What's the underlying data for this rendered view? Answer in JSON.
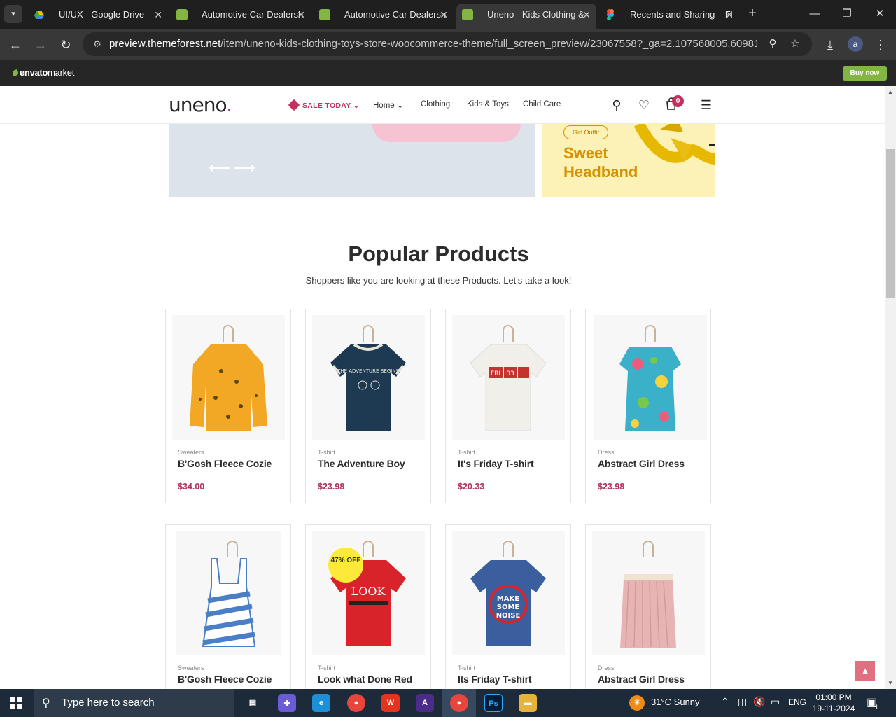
{
  "browser": {
    "tabs": [
      {
        "title": "UI/UX - Google Drive",
        "icon": "google-drive-icon",
        "color": "#34a853"
      },
      {
        "title": "Automotive Car Dealersh",
        "icon": "envato-icon",
        "color": "#82b541"
      },
      {
        "title": "Automotive Car Dealersh",
        "icon": "envato-icon",
        "color": "#82b541"
      },
      {
        "title": "Uneno - Kids Clothing &",
        "icon": "envato-icon",
        "color": "#82b541"
      },
      {
        "title": "Recents and Sharing – Fi",
        "icon": "figma-icon",
        "color": "#f24e1e"
      }
    ],
    "url_host": "preview.themeforest.net",
    "url_path": "/item/uneno-kids-clothing-toys-store-woocommerce-theme/full_screen_preview/23067558?_ga=2.107568005.609810588.1...",
    "profile_initial": "a"
  },
  "envato": {
    "logo_bold": "envato",
    "logo_light": "market",
    "buy_now": "Buy now"
  },
  "site": {
    "logo": "uneno",
    "logo_dot": ".",
    "nav": {
      "sale": "SALE TODAY",
      "home": "Home",
      "clothing": "Clothing",
      "kids_toys": "Kids & Toys",
      "child_care": "Child Care"
    },
    "cart_count": "0"
  },
  "banner_right": {
    "pill": "Girl Outfit",
    "title": "Sweet Headband"
  },
  "section": {
    "title": "Popular Products",
    "subtitle": "Shoppers like you are looking at these Products. Let's take a look!"
  },
  "products": [
    {
      "category": "Sweaters",
      "name": "B'Gosh Fleece Cozie",
      "price": "$34.00",
      "swatch": "#f2a825"
    },
    {
      "category": "T-shirt",
      "name": "The Adventure Boy",
      "price": "$23.98",
      "swatch": "#1e3a52"
    },
    {
      "category": "T-shirt",
      "name": "It's Friday T-shirt",
      "price": "$20.33",
      "swatch": "#f1efe9"
    },
    {
      "category": "Dress",
      "name": "Abstract Girl Dress",
      "price": "$23.98",
      "swatch": "#3bb0c9"
    },
    {
      "category": "Sweaters",
      "name": "B'Gosh Fleece Cozie",
      "price": "",
      "swatch": "#4a7fc7"
    },
    {
      "category": "T-shirt",
      "name": "Look what Done Red",
      "price": "",
      "swatch": "#d9232b",
      "badge": "47% OFF"
    },
    {
      "category": "T-shirt",
      "name": "Its Friday T-shirt",
      "price": "",
      "swatch": "#3b5f9e"
    },
    {
      "category": "Dress",
      "name": "Abstract Girl Dress",
      "price": "",
      "swatch": "#e7b4b4"
    }
  ],
  "product_texts": {
    "p1_text": "MAKE SOME NOISE",
    "p5_text": "LOOK",
    "p2_text": "THE ADVENTURE BEGINS"
  },
  "taskbar": {
    "search_placeholder": "Type here to search",
    "weather": "31°C  Sunny",
    "lang": "ENG",
    "time": "01:00 PM",
    "date": "19-11-2024",
    "notification_count": "1"
  }
}
